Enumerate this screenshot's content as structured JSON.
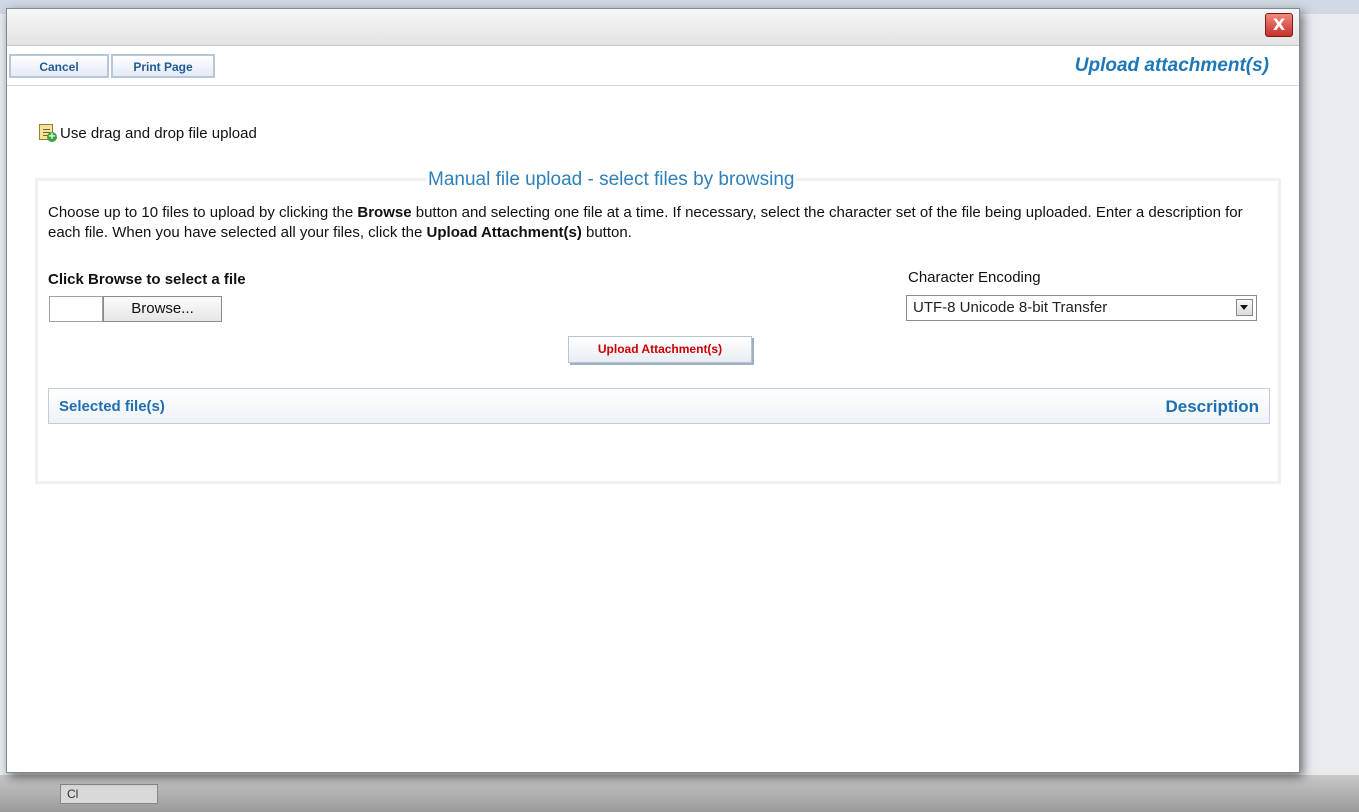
{
  "toolbar": {
    "cancel_label": "Cancel",
    "print_label": "Print Page",
    "page_title": "Upload attachment(s)"
  },
  "titlebar": {
    "close_glyph": "X"
  },
  "drag_drop": {
    "label": "Use drag and drop file upload",
    "icon": "file-add-icon"
  },
  "manual": {
    "legend": "Manual file upload - select files by browsing",
    "instructions": {
      "part1": "Choose up to 10 files to upload by clicking the ",
      "browse_bold": "Browse",
      "part2": " button and selecting one file at a time. If necessary, select the character set of the file being uploaded. Enter a description for each file. When you have selected all your files, click the ",
      "upload_bold": "Upload Attachment(s)",
      "part3": " button."
    },
    "browse_label_prefix": "Click ",
    "browse_label_bold": "Browse",
    "browse_label_suffix": " to select a file",
    "browse_button": "Browse...",
    "encoding_label": "Character Encoding",
    "encoding_value": "UTF-8 Unicode 8-bit Transfer",
    "upload_button": "Upload Attachment(s)",
    "table": {
      "columns": [
        "Selected file(s)",
        "Description"
      ]
    }
  },
  "background": {
    "behind_text": "Cl"
  },
  "colors": {
    "accent": "#1e78b8",
    "legend": "#2d80b9",
    "upload_text": "#cc0000",
    "close_red": "#c6302a"
  }
}
